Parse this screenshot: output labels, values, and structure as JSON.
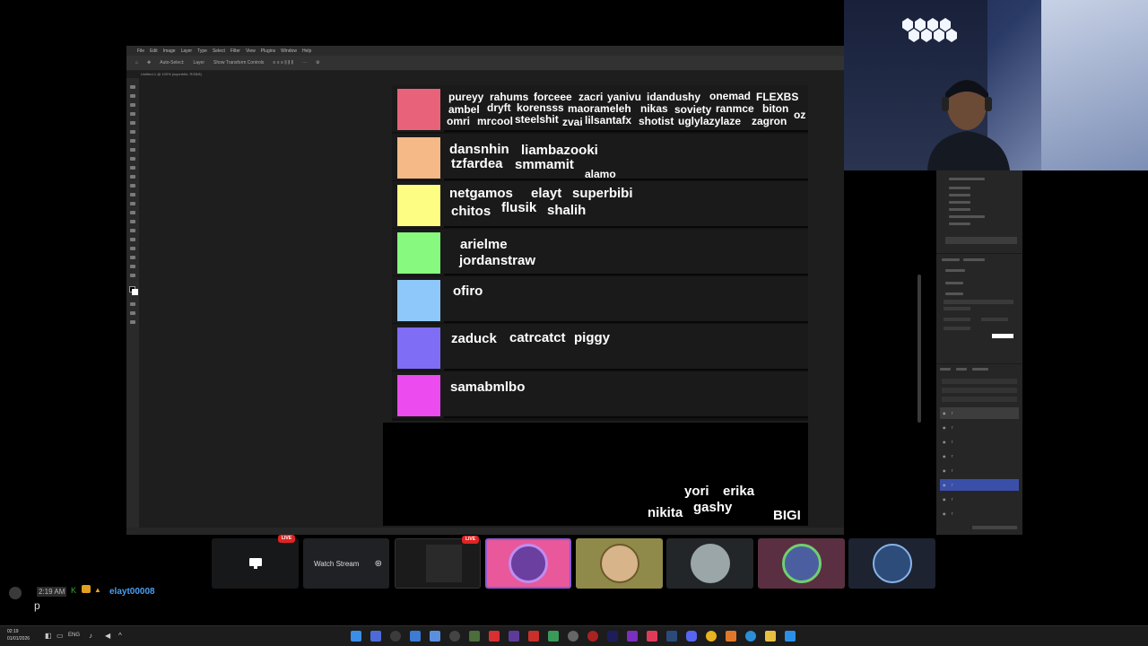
{
  "photoshop": {
    "menu": [
      "File",
      "Edit",
      "Image",
      "Layer",
      "Type",
      "Select",
      "Filter",
      "View",
      "Plugins",
      "Window",
      "Help"
    ],
    "options": [
      "Auto-Select:",
      "Layer",
      "Show Transform Controls"
    ],
    "doc_tab": "Untitled-1 @ 100% (superbibi, RGB/8)"
  },
  "tier_list": {
    "colors": [
      "#e8627a",
      "#f5b987",
      "#fdfd84",
      "#86f97e",
      "#8ec8fb",
      "#7f6ef5",
      "#eb4bef"
    ],
    "tiers": [
      {
        "names": [
          "pureyy",
          "rahums",
          "forceee",
          "zacri",
          "yanivu",
          "idandushy",
          "onemad",
          "FLEXBS",
          "ambel",
          "dryft",
          "korensss",
          "maorameleh",
          "nikas",
          "soviety",
          "ranmce",
          "biton",
          "omri",
          "mrcool",
          "steelshit",
          "zvai",
          "lilsantafx",
          "shotist",
          "uglylazylaze",
          "zagron",
          "oz"
        ]
      },
      {
        "names": [
          "dansnhin",
          "liambazooki",
          "tzfardea",
          "smmamit",
          "alamo"
        ]
      },
      {
        "names": [
          "netgamos",
          "elayt",
          "superbibi",
          "chitos",
          "flusik",
          "shalih"
        ]
      },
      {
        "names": [
          "arielme",
          "jordanstraw"
        ]
      },
      {
        "names": [
          "ofiro"
        ]
      },
      {
        "names": [
          "zaduck",
          "catrcatct",
          "piggy"
        ]
      },
      {
        "names": [
          "samabmlbo"
        ]
      }
    ],
    "unranked": [
      "yori",
      "erika",
      "nikita",
      "gashy",
      "BIGI"
    ]
  },
  "stream_bar": {
    "live_badge": "LIVE",
    "watch_label": "Watch Stream"
  },
  "discord": {
    "time": "2:19 AM",
    "username": "elayt00008",
    "message": "p"
  },
  "taskbar": {
    "time": "02:19",
    "date": "01/01/2026",
    "lang": "ENG"
  }
}
